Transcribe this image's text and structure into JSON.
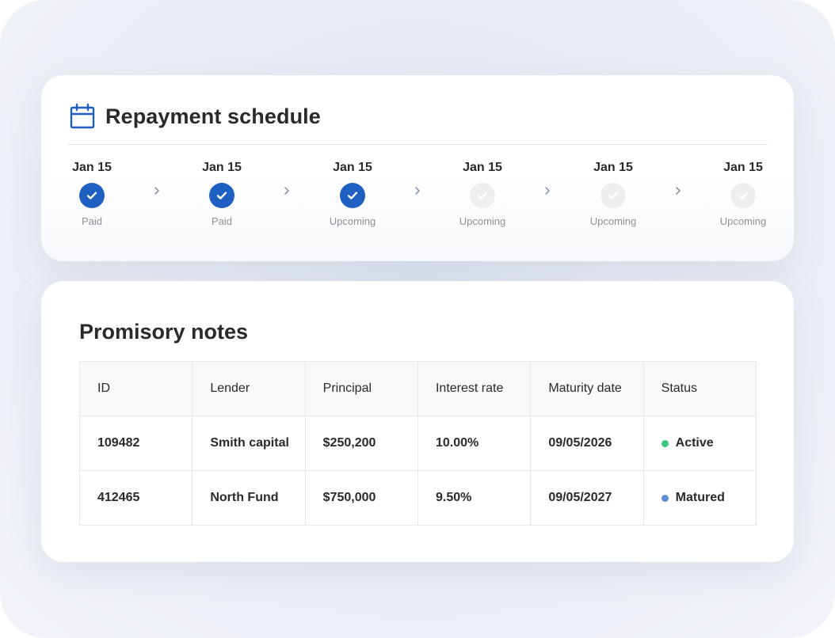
{
  "schedule": {
    "title": "Repayment schedule",
    "accent_color": "#1f5fc2",
    "steps": [
      {
        "date": "Jan 15",
        "status": "Paid",
        "checked": true
      },
      {
        "date": "Jan 15",
        "status": "Paid",
        "checked": true
      },
      {
        "date": "Jan 15",
        "status": "Upcoming",
        "checked": true
      },
      {
        "date": "Jan 15",
        "status": "Upcoming",
        "checked": false
      },
      {
        "date": "Jan 15",
        "status": "Upcoming",
        "checked": false
      },
      {
        "date": "Jan 15",
        "status": "Upcoming",
        "checked": false
      }
    ]
  },
  "notes": {
    "title": "Promisory notes",
    "columns": [
      "ID",
      "Lender",
      "Principal",
      "Interest rate",
      "Maturity date",
      "Status"
    ],
    "rows": [
      {
        "id": "109482",
        "lender": "Smith capital",
        "principal": "$250,200",
        "rate": "10.00%",
        "maturity": "09/05/2026",
        "status": "Active",
        "status_color": "#3ec77a"
      },
      {
        "id": "412465",
        "lender": "North Fund",
        "principal": "$750,000",
        "rate": "9.50%",
        "maturity": "09/05/2027",
        "status": "Matured",
        "status_color": "#5b8fd6"
      }
    ]
  }
}
